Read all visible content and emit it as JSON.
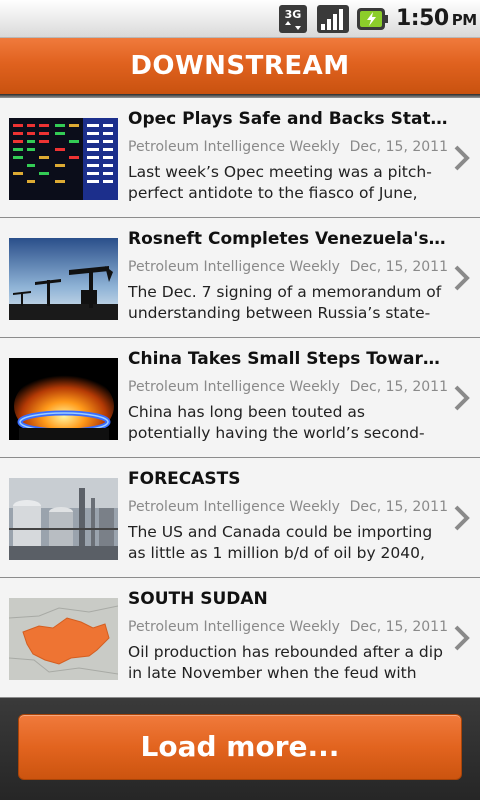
{
  "status_bar": {
    "network": "3G",
    "time": "1:50",
    "ampm": "PM",
    "icons": [
      "3g-data-icon",
      "signal-strength-icon",
      "battery-charging-icon"
    ]
  },
  "header": {
    "title": "DOWNSTREAM",
    "accent_color": "#e0621f"
  },
  "articles": [
    {
      "title": "Opec Plays Safe and Backs Status ...",
      "source": "Petroleum Intelligence Weekly",
      "date": "Dec, 15, 2011",
      "summary": "Last week’s Opec meeting was a pitch-perfect antidote to the fiasco of June,",
      "thumbnail": "stock-ticker-board"
    },
    {
      "title": "Rosneft Completes Venezuela's Car...",
      "source": "Petroleum Intelligence Weekly",
      "date": "Dec, 15, 2011",
      "summary": "The Dec. 7 signing of a memorandum of understanding between Russia’s state-",
      "thumbnail": "oil-pumpjacks-silhouette"
    },
    {
      "title": "China Takes Small Steps Toward Sh...",
      "source": "Petroleum Intelligence Weekly",
      "date": "Dec, 15, 2011",
      "summary": "China has long been touted as potentially having the world’s second-biggest shale",
      "thumbnail": "gas-flame"
    },
    {
      "title": "FORECASTS",
      "source": "Petroleum Intelligence Weekly",
      "date": "Dec, 15, 2011",
      "summary": "The US and Canada could be importing as little as 1 million b/d of oil by 2040,",
      "thumbnail": "refinery-tanks"
    },
    {
      "title": "SOUTH SUDAN",
      "source": "Petroleum Intelligence Weekly",
      "date": "Dec, 15, 2011",
      "summary": "Oil production has rebounded after a dip in late November when the feud with",
      "thumbnail": "south-sudan-map"
    }
  ],
  "footer": {
    "load_more_label": "Load more..."
  }
}
